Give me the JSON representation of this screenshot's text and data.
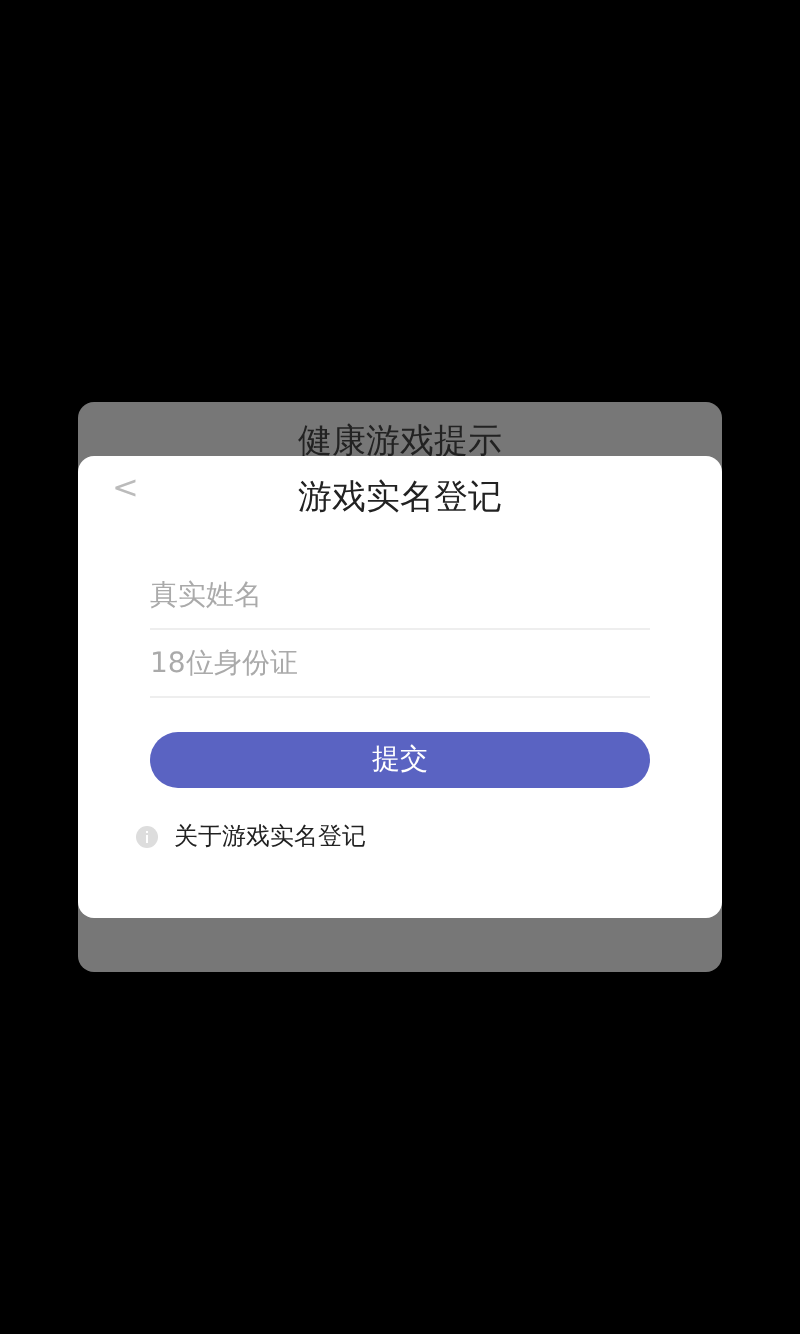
{
  "background_dialog": {
    "title": "健康游戏提示"
  },
  "dialog": {
    "back": "<",
    "title": "游戏实名登记",
    "fields": [
      {
        "placeholder": "真实姓名"
      },
      {
        "placeholder": "18位身份证"
      }
    ],
    "submit": "提交",
    "info_link": "关于游戏实名登记"
  }
}
